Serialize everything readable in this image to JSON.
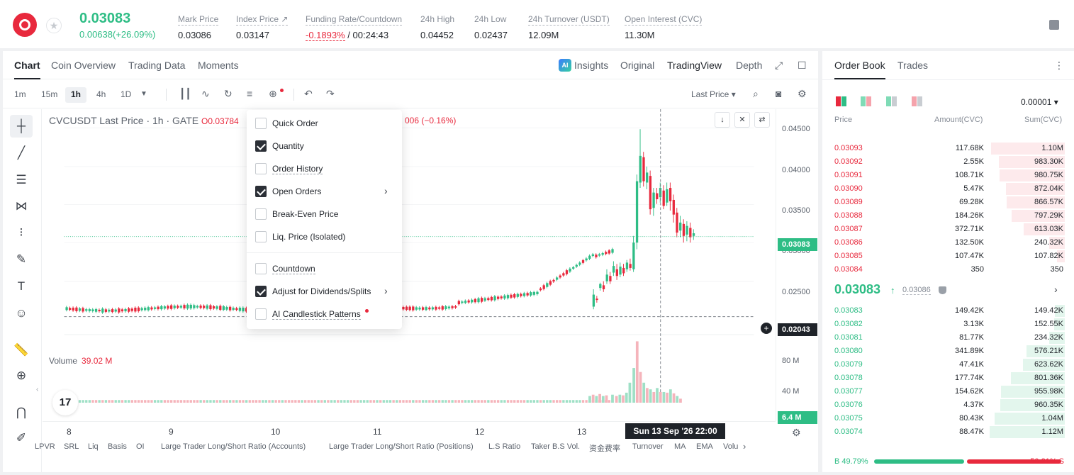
{
  "header": {
    "last_price": "0.03083",
    "change": "0.00638(+26.09%)",
    "stats": [
      {
        "label": "Mark Price",
        "value": "0.03086"
      },
      {
        "label": "Index Price ↗",
        "value": "0.03147"
      },
      {
        "label": "Funding Rate/Countdown",
        "value_neg": "-0.1893%",
        "value": "/ 00:24:43"
      },
      {
        "label": "24h High",
        "value": "0.04452"
      },
      {
        "label": "24h Low",
        "value": "0.02437"
      },
      {
        "label": "24h Turnover (USDT)",
        "value": "12.09M"
      },
      {
        "label": "Open Interest (CVC)",
        "value": "11.30M"
      }
    ]
  },
  "chart_panel": {
    "tabs": [
      "Chart",
      "Coin Overview",
      "Trading Data",
      "Moments"
    ],
    "views": [
      "Insights",
      "Original",
      "TradingView",
      "Depth"
    ],
    "ai_badge": "AI",
    "intervals": [
      "1m",
      "15m",
      "1h",
      "4h",
      "1D"
    ],
    "price_type": "Last Price ▾",
    "legend": {
      "symbol": "CVCUSDT Last Price · 1h · GATE",
      "ohlc_head": "O0.03784",
      "ohlc_tail": "006 (−0.16%)"
    },
    "volume_legend": {
      "label": "Volume",
      "value": "39.02 M"
    },
    "y_ticks": [
      "0.04500",
      "0.04000",
      "0.03500",
      "0.03000",
      "0.02500"
    ],
    "y_last_price": "0.03083",
    "y_crosshair": "0.02043",
    "vol_ticks": [
      "80 M",
      "40 M"
    ],
    "vol_current": "6.4 M",
    "x_ticks": [
      "8",
      "9",
      "10",
      "11",
      "12",
      "13"
    ],
    "crosshair_time": "Sun 13 Sep '26   22:00",
    "tv_logo": "17",
    "indicators": [
      "LPVR",
      "SRL",
      "Liq",
      "Basis",
      "OI",
      "Large Trader Long/Short Ratio (Accounts)",
      "Large Trader Long/Short Ratio (Positions)",
      "L.S Ratio",
      "Taker B.S Vol.",
      "资金费率",
      "Turnover",
      "MA",
      "EMA",
      "Volu"
    ]
  },
  "dropdown": {
    "items": [
      {
        "label": "Quick Order",
        "checked": false
      },
      {
        "label": "Quantity",
        "checked": true
      },
      {
        "label": "Order History",
        "checked": false
      },
      {
        "label": "Open Orders",
        "checked": true
      },
      {
        "label": "Break-Even Price",
        "checked": false
      },
      {
        "label": "Liq. Price (Isolated)",
        "checked": false
      },
      {
        "label": "Countdown",
        "checked": false
      },
      {
        "label": "Adjust for Dividends/Splits",
        "checked": true
      },
      {
        "label": "AI Candlestick Patterns",
        "checked": false
      }
    ]
  },
  "order_book": {
    "tabs": [
      "Order Book",
      "Trades"
    ],
    "precision": "0.00001 ▾",
    "columns": [
      "Price",
      "Amount(CVC)",
      "Sum(CVC)"
    ],
    "asks": [
      {
        "price": "0.03093",
        "amount": "117.68K",
        "sum": "1.10M",
        "depth": 0.98
      },
      {
        "price": "0.03092",
        "amount": "2.55K",
        "sum": "983.30K",
        "depth": 0.88
      },
      {
        "price": "0.03091",
        "amount": "108.71K",
        "sum": "980.75K",
        "depth": 0.87
      },
      {
        "price": "0.03090",
        "amount": "5.47K",
        "sum": "872.04K",
        "depth": 0.78
      },
      {
        "price": "0.03089",
        "amount": "69.28K",
        "sum": "866.57K",
        "depth": 0.77
      },
      {
        "price": "0.03088",
        "amount": "184.26K",
        "sum": "797.29K",
        "depth": 0.71
      },
      {
        "price": "0.03087",
        "amount": "372.71K",
        "sum": "613.03K",
        "depth": 0.55
      },
      {
        "price": "0.03086",
        "amount": "132.50K",
        "sum": "240.32K",
        "depth": 0.21
      },
      {
        "price": "0.03085",
        "amount": "107.47K",
        "sum": "107.82K",
        "depth": 0.1
      },
      {
        "price": "0.03084",
        "amount": "350",
        "sum": "350",
        "depth": 0.0
      }
    ],
    "mid": {
      "price": "0.03083",
      "arrow": "↑",
      "mark": "0.03086"
    },
    "bids": [
      {
        "price": "0.03083",
        "amount": "149.42K",
        "sum": "149.42K",
        "depth": 0.13
      },
      {
        "price": "0.03082",
        "amount": "3.13K",
        "sum": "152.55K",
        "depth": 0.14
      },
      {
        "price": "0.03081",
        "amount": "81.77K",
        "sum": "234.32K",
        "depth": 0.21
      },
      {
        "price": "0.03080",
        "amount": "341.89K",
        "sum": "576.21K",
        "depth": 0.51
      },
      {
        "price": "0.03079",
        "amount": "47.41K",
        "sum": "623.62K",
        "depth": 0.56
      },
      {
        "price": "0.03078",
        "amount": "177.74K",
        "sum": "801.36K",
        "depth": 0.72
      },
      {
        "price": "0.03077",
        "amount": "154.62K",
        "sum": "955.98K",
        "depth": 0.85
      },
      {
        "price": "0.03076",
        "amount": "4.37K",
        "sum": "960.35K",
        "depth": 0.86
      },
      {
        "price": "0.03075",
        "amount": "80.43K",
        "sum": "1.04M",
        "depth": 0.93
      },
      {
        "price": "0.03074",
        "amount": "88.47K",
        "sum": "1.12M",
        "depth": 1.0
      }
    ],
    "buy_ratio": "B 49.79%",
    "sell_ratio": "50.21% S",
    "buy_pct": 49.79
  },
  "colors": {
    "up": "#2ebd85",
    "down": "#e8293d",
    "accent": "#1f2329"
  }
}
